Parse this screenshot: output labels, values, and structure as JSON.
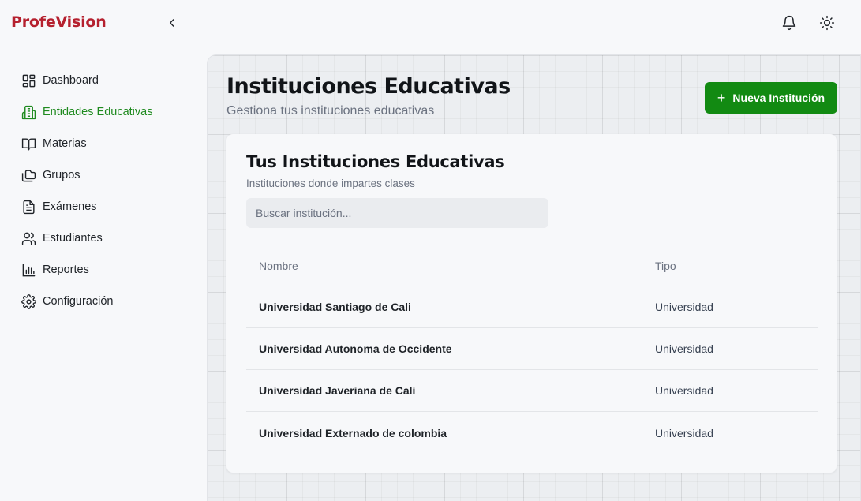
{
  "app": {
    "brand": "ProfeVision"
  },
  "sidebar": {
    "items": [
      {
        "label": "Dashboard",
        "icon": "dashboard-icon"
      },
      {
        "label": "Entidades Educativas",
        "icon": "building-icon",
        "active": true
      },
      {
        "label": "Materias",
        "icon": "book-icon"
      },
      {
        "label": "Grupos",
        "icon": "folders-icon"
      },
      {
        "label": "Exámenes",
        "icon": "file-text-icon"
      },
      {
        "label": "Estudiantes",
        "icon": "users-icon"
      },
      {
        "label": "Reportes",
        "icon": "bar-chart-icon"
      },
      {
        "label": "Configuración",
        "icon": "gear-icon"
      }
    ]
  },
  "header": {
    "title": "Instituciones Educativas",
    "subtitle": "Gestiona tus instituciones educativas",
    "new_button": "Nueva Institución"
  },
  "card": {
    "title": "Tus Instituciones Educativas",
    "subtitle": "Instituciones donde impartes clases",
    "search_placeholder": "Buscar institución...",
    "columns": [
      "Nombre",
      "Tipo"
    ],
    "rows": [
      {
        "name": "Universidad Santiago de Cali",
        "type": "Universidad"
      },
      {
        "name": "Universidad Autonoma de Occidente",
        "type": "Universidad"
      },
      {
        "name": "Universidad Javeriana de Cali",
        "type": "Universidad"
      },
      {
        "name": "Universidad Externado de colombia",
        "type": "Universidad"
      }
    ]
  },
  "colors": {
    "brand": "#b5202e",
    "accent": "#128a12",
    "active_nav": "#1f8a1f"
  }
}
